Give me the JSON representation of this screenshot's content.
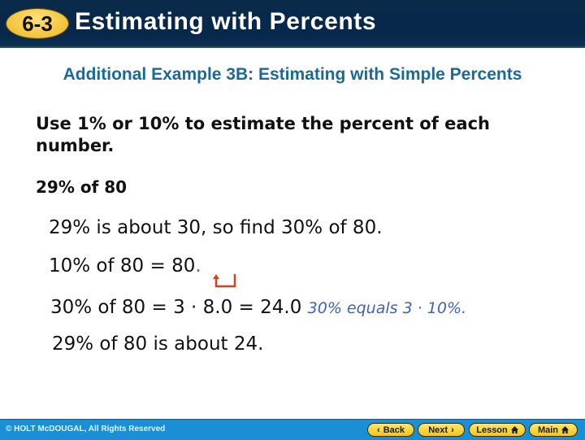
{
  "header": {
    "lesson_badge": "6-3",
    "title": "Estimating with Percents"
  },
  "content": {
    "subtitle": "Additional Example 3B: Estimating with Simple Percents",
    "instruction": "Use 1% or 10% to estimate the percent of each number.",
    "problem": "29% of 80",
    "steps": {
      "step1": "29% is about 30, so find 30% of 80.",
      "step2_prefix": "10% of 80 = 8",
      "step2_digit": "0",
      "step2_old_decimal": ".",
      "step3": "30% of 80 = 3 · 8.0 = 24.0",
      "step3_note": "30% equals 3 · 10%.",
      "step4": "29% of 80 is about 24."
    },
    "accent_colors": {
      "subtitle": "#1b6a96",
      "note": "#3e63b8",
      "decimal_arrow": "#d6411f"
    }
  },
  "footer": {
    "copyright": "© HOLT McDOUGAL, All Rights Reserved",
    "nav": {
      "back": "Back",
      "next": "Next",
      "lesson": "Lesson",
      "main": "Main"
    }
  }
}
